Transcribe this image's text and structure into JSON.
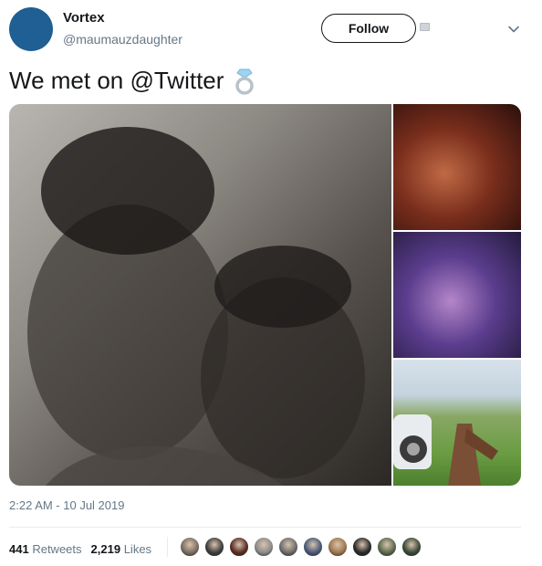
{
  "user": {
    "display_name": "Vortex",
    "handle": "@maumauzdaughter",
    "avatar_color": "#1f5f93"
  },
  "follow_label": "Follow",
  "tweet": {
    "text": "We met on @Twitter",
    "emoji_icon": "ring-icon",
    "timestamp": "2:22 AM - 10 Jul 2019"
  },
  "stats": {
    "retweets_count": "441",
    "retweets_label": "Retweets",
    "likes_count": "2,219",
    "likes_label": "Likes"
  },
  "likers": [
    {
      "color": "#7b6f63"
    },
    {
      "color": "#3e3e3e"
    },
    {
      "color": "#5a2e24"
    },
    {
      "color": "#8c8c8c"
    },
    {
      "color": "#6d6d6d"
    },
    {
      "color": "#4a5a7a"
    },
    {
      "color": "#a07850"
    },
    {
      "color": "#2b2b2b"
    },
    {
      "color": "#5b6b4e"
    },
    {
      "color": "#3a4a3a"
    }
  ],
  "colors": {
    "text_primary": "#14171a",
    "text_secondary": "#657786",
    "divider": "#e6ecf0"
  }
}
